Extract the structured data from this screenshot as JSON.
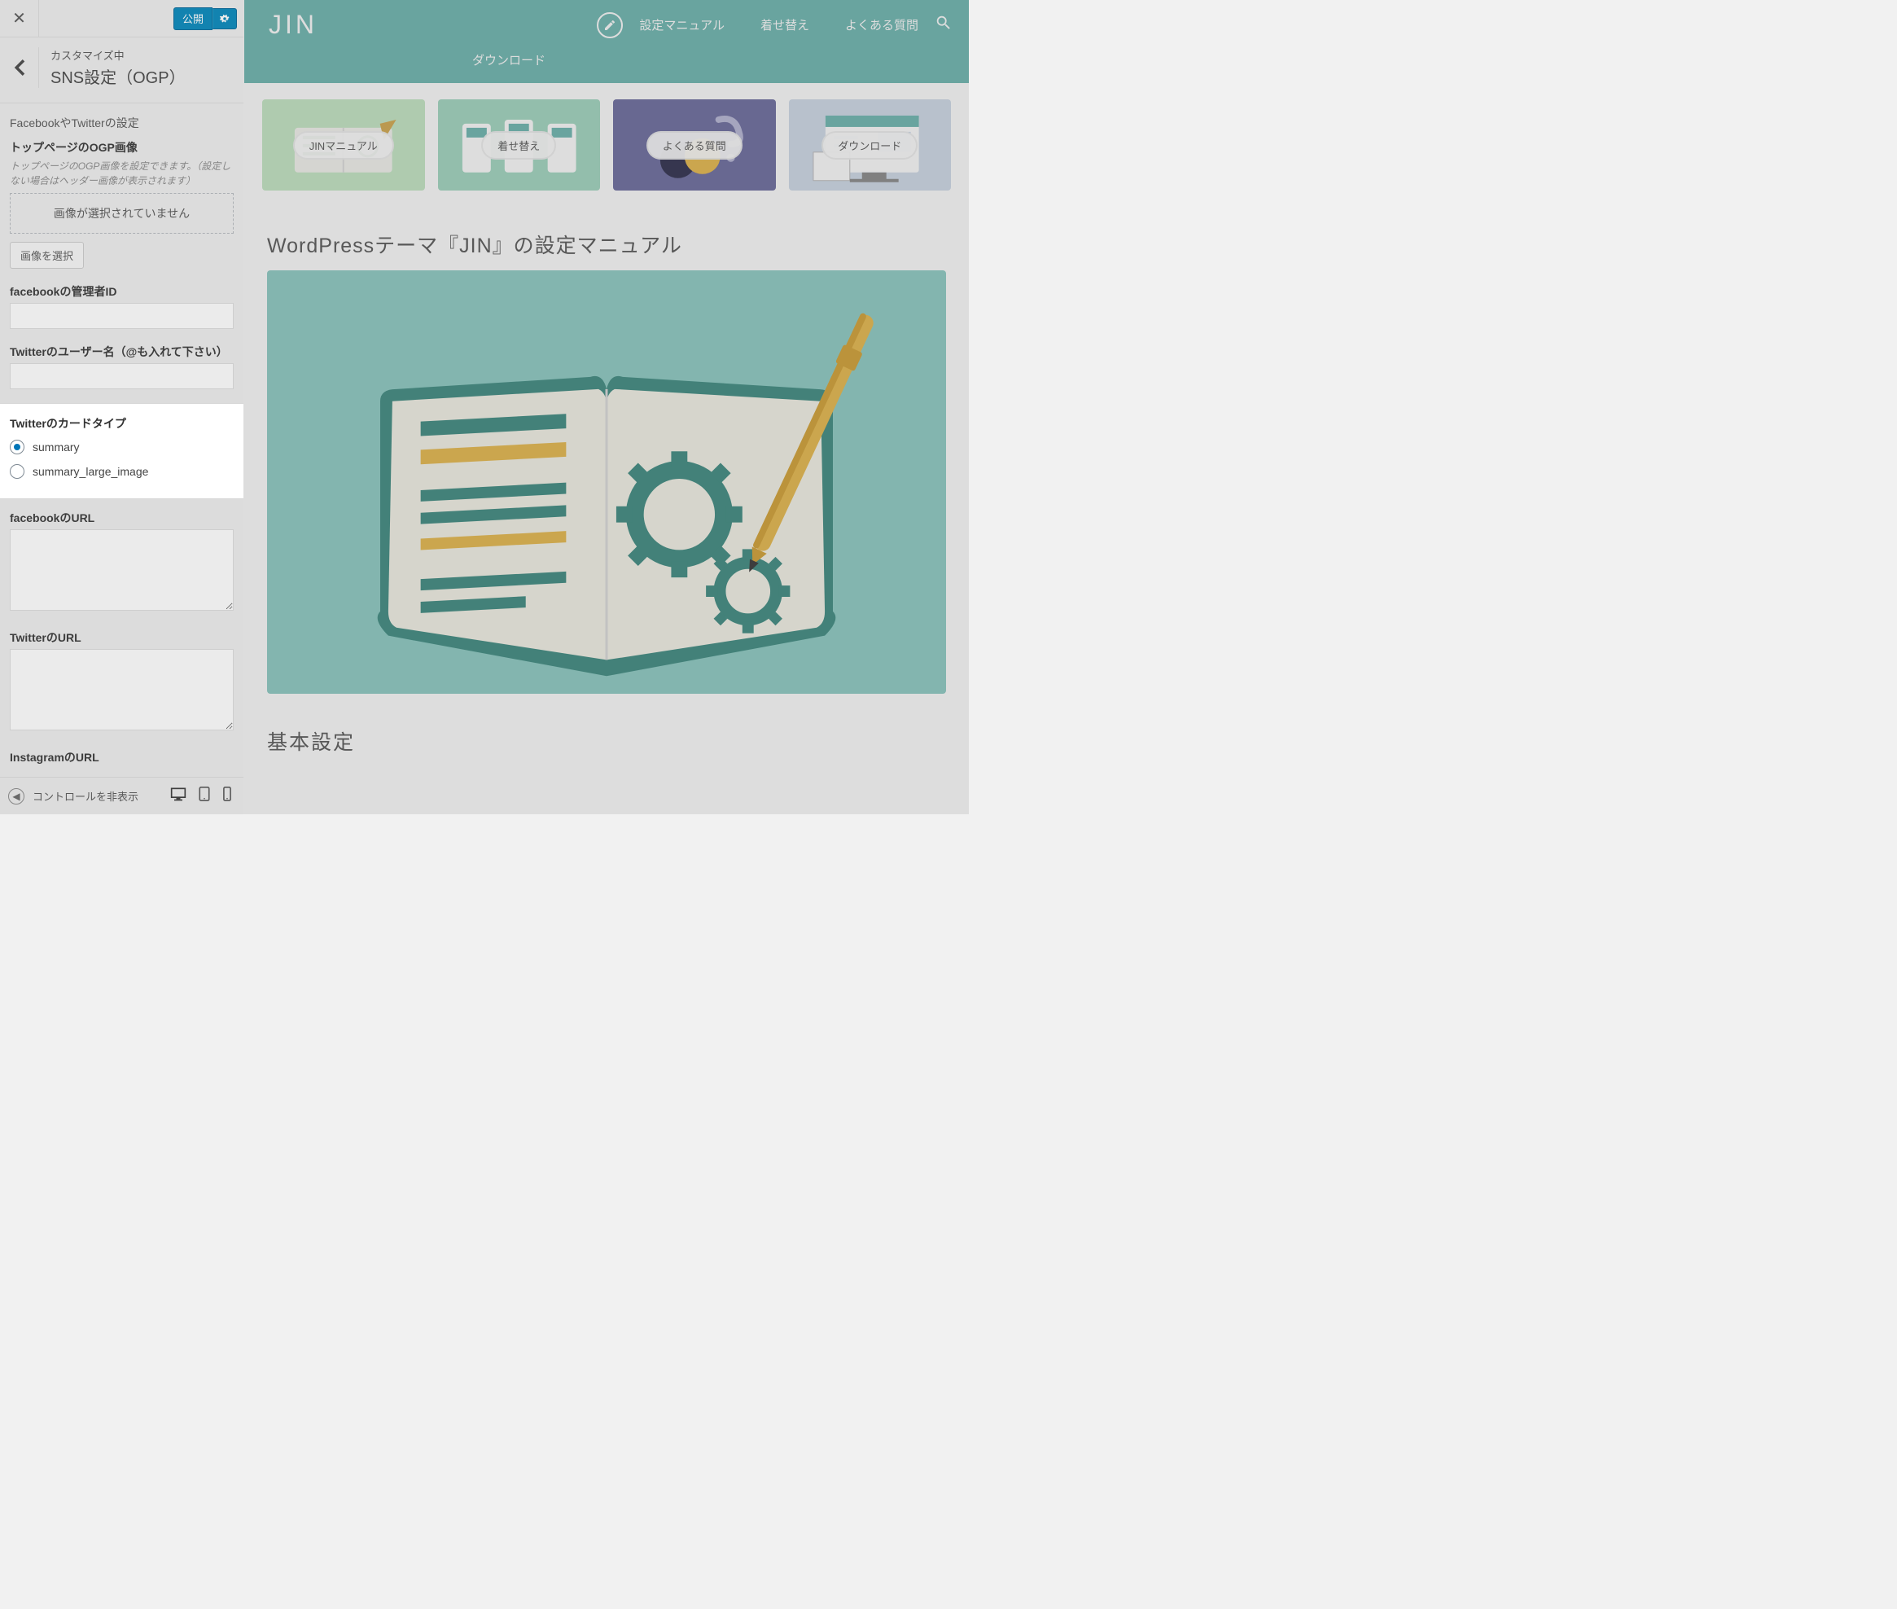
{
  "sidebar": {
    "publish_label": "公開",
    "customizing_label": "カスタマイズ中",
    "section_title": "SNS設定（OGP）",
    "description": "FacebookやTwitterの設定",
    "ogp": {
      "label": "トップページのOGP画像",
      "help": "トップページのOGP画像を設定できます。（設定しない場合はヘッダー画像が表示されます）",
      "no_image": "画像が選択されていません",
      "select_btn": "画像を選択"
    },
    "fb_admin_label": "facebookの管理者ID",
    "twitter_user_label": "Twitterのユーザー名（@も入れて下さい）",
    "twitter_card": {
      "label": "Twitterのカードタイプ",
      "options": [
        "summary",
        "summary_large_image"
      ],
      "selected": "summary"
    },
    "fb_url_label": "facebookのURL",
    "twitter_url_label": "TwitterのURL",
    "instagram_url_label": "InstagramのURL",
    "collapse_label": "コントロールを非表示"
  },
  "preview": {
    "logo": "JIN",
    "menu": [
      "設定マニュアル",
      "着せ替え",
      "よくある質問",
      "ダウンロード"
    ],
    "cards": [
      "JINマニュアル",
      "着せ替え",
      "よくある質問",
      "ダウンロード"
    ],
    "page_title": "WordPressテーマ『JIN』の設定マニュアル",
    "h2": "基本設定"
  }
}
